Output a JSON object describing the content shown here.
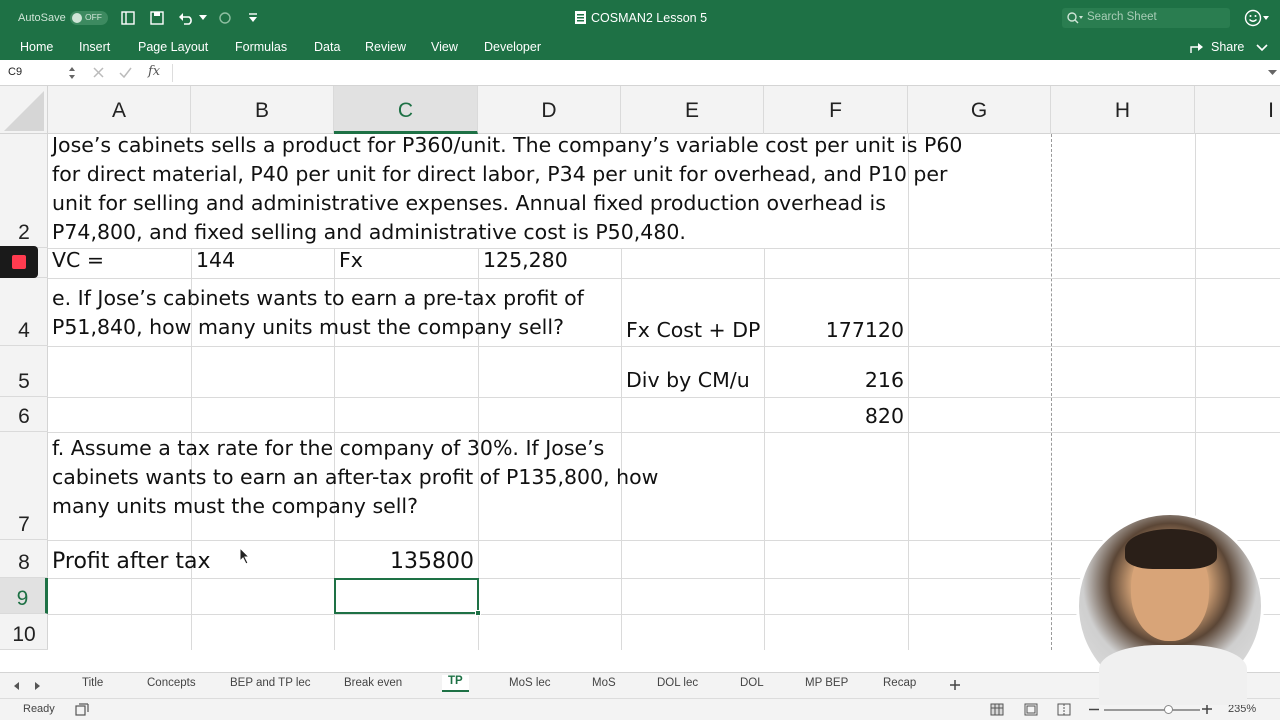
{
  "titlebar": {
    "autosave_label": "AutoSave",
    "autosave_state": "OFF",
    "title": "COSMAN2 Lesson 5",
    "search_placeholder": "Search Sheet",
    "share_label": "Share"
  },
  "ribbon": {
    "tabs": [
      "Home",
      "Insert",
      "Page Layout",
      "Formulas",
      "Data",
      "Review",
      "View",
      "Developer"
    ]
  },
  "formula_bar": {
    "name_box": "C9",
    "fx": "fx",
    "content": ""
  },
  "columns": [
    "A",
    "B",
    "C",
    "D",
    "E",
    "F",
    "G",
    "H",
    "I"
  ],
  "active_column": "C",
  "rows": [
    "2",
    "",
    "4",
    "5",
    "6",
    "7",
    "8",
    "9",
    "10"
  ],
  "active_row": "9",
  "cells": {
    "a2_line1": "Jose’s cabinets sells a product for P360/unit. The company’s variable cost per unit is P60",
    "a2_line2": "for direct material, P40 per unit for direct labor, P34 per unit for overhead, and P10 per",
    "a2_line3": "unit for selling and administrative expenses. Annual fixed production overhead is",
    "a2_line4": "P74,800, and fixed selling and administrative cost is P50,480.",
    "a3": "VC =",
    "b3": "144",
    "c3": "Fx",
    "d3": "125,280",
    "a4_line1": "e. If Jose’s cabinets wants to earn a pre-tax profit of",
    "a4_line2": "P51,840, how many units must the company sell?",
    "e4": "Fx Cost + DP",
    "f4": "177120",
    "e5": "Div by CM/u",
    "f5": "216",
    "f6": "820",
    "a7_line1": "f. Assume a tax rate for the company of 30%. If Jose’s",
    "a7_line2": "cabinets wants to earn an after-tax profit of P135,800, how",
    "a7_line3": "many units must the company sell?",
    "a8": "Profit after tax",
    "c8": "135800"
  },
  "sheet_tabs": [
    "Title",
    "Concepts",
    "BEP and TP lec",
    "Break even",
    "TP",
    "MoS lec",
    "MoS",
    "DOL lec",
    "DOL",
    "MP BEP",
    "Recap"
  ],
  "active_sheet": "TP",
  "status": {
    "ready": "Ready",
    "zoom": "235%"
  },
  "colors": {
    "excel_green": "#1e7145"
  }
}
